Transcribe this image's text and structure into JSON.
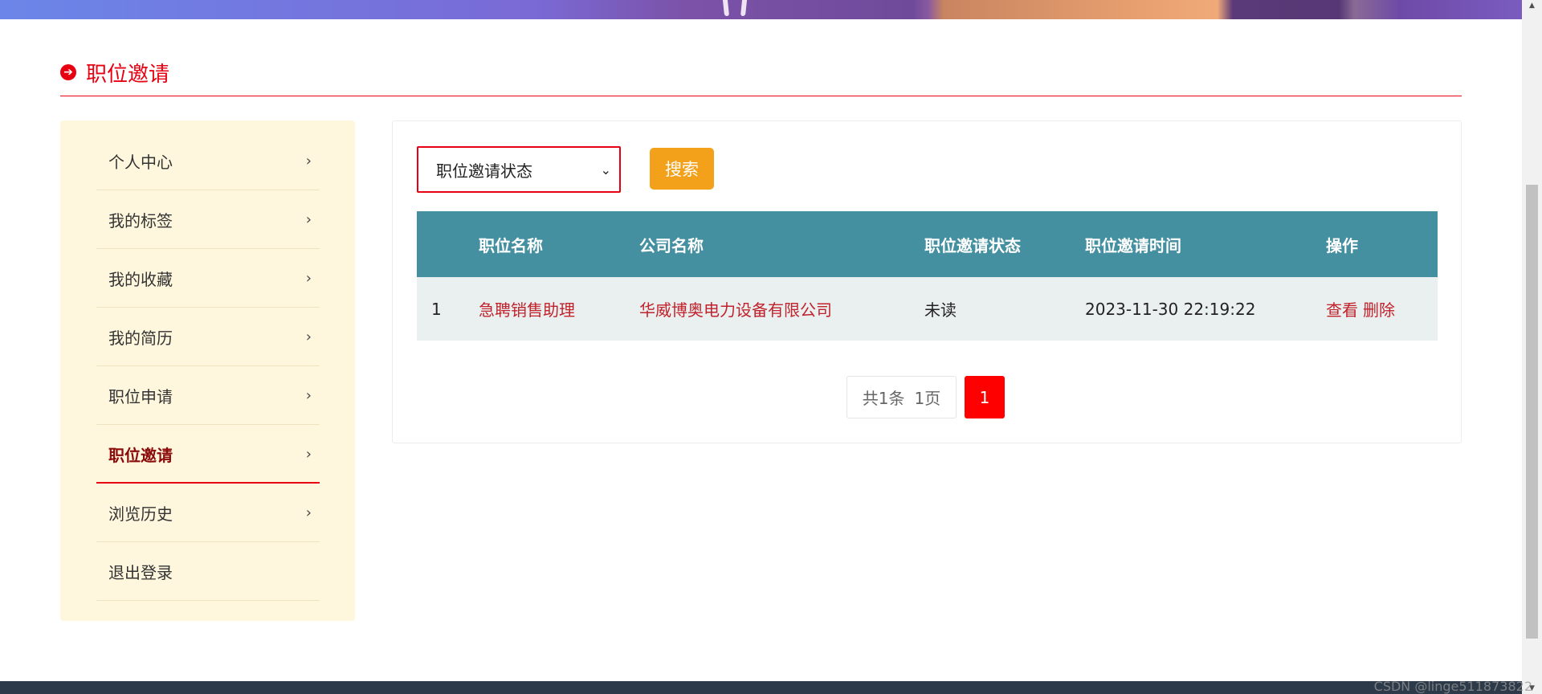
{
  "section": {
    "title": "职位邀请"
  },
  "sidebar": {
    "items": [
      {
        "label": "个人中心",
        "chevron": true,
        "active": false
      },
      {
        "label": "我的标签",
        "chevron": true,
        "active": false
      },
      {
        "label": "我的收藏",
        "chevron": true,
        "active": false
      },
      {
        "label": "我的简历",
        "chevron": true,
        "active": false
      },
      {
        "label": "职位申请",
        "chevron": true,
        "active": false
      },
      {
        "label": "职位邀请",
        "chevron": true,
        "active": true
      },
      {
        "label": "浏览历史",
        "chevron": true,
        "active": false
      },
      {
        "label": "退出登录",
        "chevron": false,
        "active": false
      }
    ]
  },
  "filter": {
    "status_select": {
      "selected": "职位邀请状态"
    },
    "search_label": "搜索"
  },
  "table": {
    "headers": [
      "",
      "职位名称",
      "公司名称",
      "职位邀请状态",
      "职位邀请时间",
      "操作"
    ],
    "rows": [
      {
        "index": "1",
        "job_name": "急聘销售助理",
        "company": "华威博奥电力设备有限公司",
        "status": "未读",
        "time": "2023-11-30 22:19:22",
        "actions": [
          "查看",
          "删除"
        ]
      }
    ]
  },
  "pagination": {
    "total": "共1条",
    "pages": "1页",
    "current": "1"
  },
  "watermark": "CSDN @linge511873822",
  "colors": {
    "accent": "#e60012",
    "table_header": "#448fa0",
    "search_button": "#f3a01b",
    "sidebar_bg": "#fef7dd"
  }
}
